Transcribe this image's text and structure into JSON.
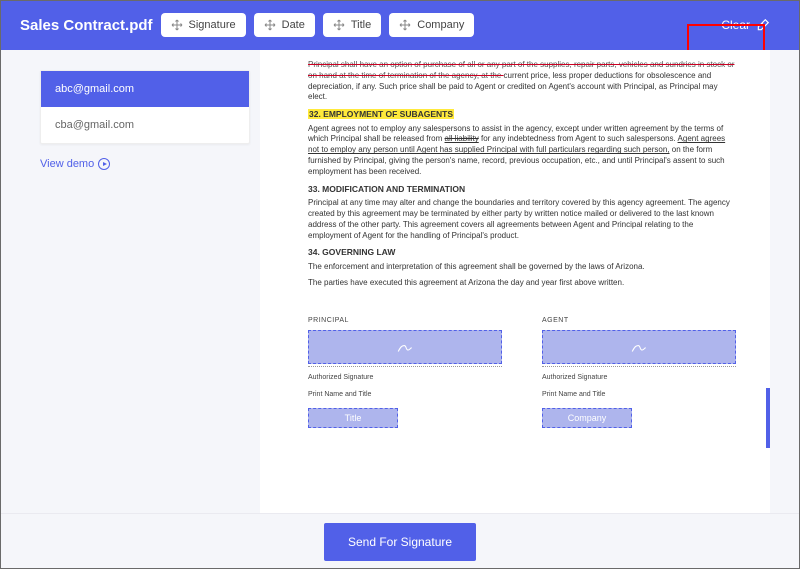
{
  "header": {
    "title": "Sales Contract.pdf",
    "tools": [
      {
        "label": "Signature",
        "name": "signature-tool"
      },
      {
        "label": "Date",
        "name": "date-tool"
      },
      {
        "label": "Title",
        "name": "title-tool"
      },
      {
        "label": "Company",
        "name": "company-tool"
      }
    ],
    "clear_label": "Clear"
  },
  "sidebar": {
    "emails": [
      {
        "address": "abc@gmail.com",
        "active": true
      },
      {
        "address": "cba@gmail.com",
        "active": false
      }
    ],
    "demo_label": "View demo"
  },
  "document": {
    "intro_strike": "Principal shall have an option of purchase of all or any part of the supplies, repair parts, vehicles and sundries in stock or on hand at the time of termination of the agency, at the ",
    "intro_rest": "current price, less proper deductions for obsolescence and depreciation, if any. Such price shall be paid to Agent or credited on Agent's account with Principal, as Principal may elect.",
    "s32_title": "32.   EMPLOYMENT OF SUBAGENTS",
    "s32_body_a": "Agent agrees not to employ any salespersons to assist in the agency, except under written agreement by the terms of which Principal shall be released from ",
    "s32_strike_a": "all liability",
    "s32_body_b": " for any indebtedness from Agent to such salespersons. ",
    "s32_under": "Agent agrees not to employ any person until Agent has supplied Principal with full particulars regarding such person,",
    "s32_body_c": " on the form furnished by Principal, giving the person's name, record, previous occupation, etc., and until Principal's assent to such employment has been received.",
    "s33_title": "33.   MODIFICATION AND TERMINATION",
    "s33_body": "Principal at any time may alter and change the boundaries and territory covered by this agency agreement. The agency created by this agreement may be terminated by either party by written notice mailed or delivered to the last known address of the other party. This agreement covers all agreements between Agent and Principal relating to the employment of Agent for the handling of Principal's product.",
    "s34_title": "34.   GOVERNING LAW",
    "s34_body_a": "The enforcement and interpretation of this agreement shall be governed by the laws of Arizona.",
    "s34_body_b": "The parties have executed this agreement at Arizona the day and year first above written.",
    "principal_label": "PRINCIPAL",
    "agent_label": "AGENT",
    "auth_sig_label": "Authorized Signature",
    "print_label": "Print Name and Title",
    "title_field": "Title",
    "company_field": "Company"
  },
  "footer": {
    "send_label": "Send For Signature"
  }
}
